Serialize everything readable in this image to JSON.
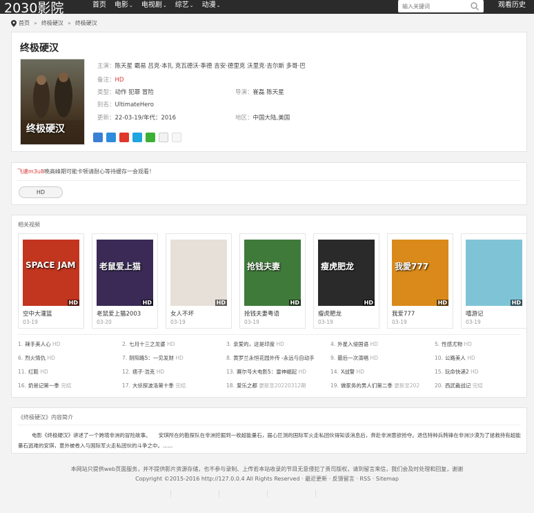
{
  "header": {
    "logo": "2030影院",
    "nav": [
      {
        "label": "首页",
        "dropdown": false
      },
      {
        "label": "电影",
        "dropdown": true
      },
      {
        "label": "电视剧",
        "dropdown": true
      },
      {
        "label": "综艺",
        "dropdown": true
      },
      {
        "label": "动漫",
        "dropdown": true
      }
    ],
    "search_placeholder": "输入关键词",
    "history": "观看历史"
  },
  "breadcrumb": [
    "首页",
    "终极硬汉",
    "终极硬汉"
  ],
  "breadcrumb_sep": "»",
  "movie": {
    "title": "终极硬汉",
    "cast_label": "主演：",
    "cast": "陈天星 霸易 吕克·本扎 克瓦德沃·季德 吉安·德里克 沃里克·吉尔斯 多哥·巴",
    "note_label": "备注：",
    "note": "HD",
    "genre_label": "类型：",
    "genre": "动作 犯罪 冒险",
    "director_label": "导演：",
    "director": "崔磊 陈天星",
    "alias_label": "别名：",
    "alias": "UltimateHero",
    "updated_label": "更新：",
    "updated": "22-03-19/年代：2016",
    "region_label": "地区：",
    "region": "中国大陆,美国",
    "poster_text": "终极硬汉"
  },
  "play": {
    "notice_red": "飞速m3u8",
    "notice": "晚高峰期可能卡顿请耐心等待缓存一会观看！",
    "source_button": "HD"
  },
  "related": {
    "title": "相关视频",
    "hd_tag": "HD",
    "items": [
      {
        "name": "空中大灌篮",
        "date": "03-19",
        "poster": "SPACE JAM",
        "bg": "#c2351f"
      },
      {
        "name": "老鼠爱上猫2003",
        "date": "03-20",
        "poster": "老鼠爱上猫",
        "bg": "#3a2a55"
      },
      {
        "name": "女人不坏",
        "date": "03-19",
        "poster": "",
        "bg": "#e6e0d8"
      },
      {
        "name": "抢钱夫妻粤语",
        "date": "03-19",
        "poster": "抢钱夫妻",
        "bg": "#3f7a3a"
      },
      {
        "name": "瘦虎肥龙",
        "date": "03-19",
        "poster": "瘦虎肥龙",
        "bg": "#2a2a2a"
      },
      {
        "name": "我爱777",
        "date": "03-19",
        "poster": "我愛777",
        "bg": "#d98a1a"
      },
      {
        "name": "嘻游记",
        "date": "03-19",
        "poster": "",
        "bg": "#7fc4d6"
      }
    ],
    "rank": [
      {
        "n": "1.",
        "name": "辣手美人心",
        "st": "HD"
      },
      {
        "n": "2.",
        "name": "七月十三之龙婆",
        "st": "HD"
      },
      {
        "n": "3.",
        "name": "亲爱的，这是印度",
        "st": "HD"
      },
      {
        "n": "4.",
        "name": "外星入侵国语",
        "st": "HD"
      },
      {
        "n": "5.",
        "name": "性感尤物",
        "st": "HD"
      },
      {
        "n": "6.",
        "name": "烈火情仇",
        "st": "HD"
      },
      {
        "n": "7.",
        "name": "阴阳路5：一见发财",
        "st": "HD"
      },
      {
        "n": "8.",
        "name": "黄罗兰永恒花园外传 -永远与自动手",
        "st": ""
      },
      {
        "n": "9.",
        "name": "最后一次演唱",
        "st": "HD"
      },
      {
        "n": "10.",
        "name": "公路美人",
        "st": "HD"
      },
      {
        "n": "11.",
        "name": "红鞋",
        "st": "HD"
      },
      {
        "n": "12.",
        "name": "痞子·浩克",
        "st": "HD"
      },
      {
        "n": "13.",
        "name": "赛尔号大电影5：雷神崛起",
        "st": "HD"
      },
      {
        "n": "14.",
        "name": "X战警",
        "st": "HD"
      },
      {
        "n": "15.",
        "name": "玩命快递2",
        "st": "HD"
      },
      {
        "n": "16.",
        "name": "奶爸记第一季",
        "st": "完结"
      },
      {
        "n": "17.",
        "name": "大侦探波洛第十季",
        "st": "完结"
      },
      {
        "n": "18.",
        "name": "爱乐之都",
        "st": "更新至20220312期"
      },
      {
        "n": "19.",
        "name": "做家务的男人们第二季",
        "st": "更新至202"
      },
      {
        "n": "20.",
        "name": "西武裁战记",
        "st": "完结"
      }
    ]
  },
  "intro": {
    "title": "《终极硬汉》内容简介",
    "text": "电影《终极硬汉》讲述了一个跨境非洲的冒险故事。　　安琪所在的勘探队在非洲挖掘到一枚超能量石，届心叵测的国际军火走私团伙得知该消息后，奔赴非洲意欲抢夺。退伍特种兵韩锋在非洲沙漠为了拯救持有超能量石逃难的安琪，意外被卷入与国际军火走私团伙的斗争之中。......"
  },
  "footer": {
    "line1": "本网站只提供web页面服务，并不提供影片资源存储，也不参与录制、上传若本站收录的节目无意侵犯了贵司版权，请到留言来信，我们会及时处理和回复，谢谢",
    "line2": "Copyright ©2015-2016 http://127.0.0.4 All Rights Reserved · 最近更新 · 反馈留言 · RSS · Sitemap"
  }
}
